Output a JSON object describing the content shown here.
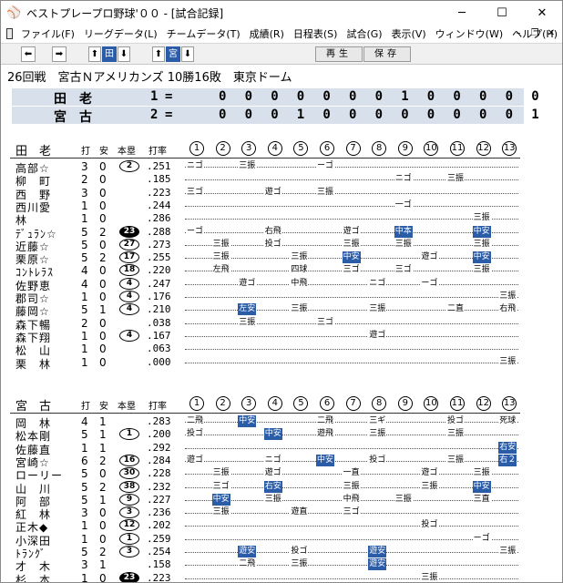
{
  "window": {
    "title": "ベストプレープロ野球'００ - [試合記録]",
    "minimize": "─",
    "maximize": "☐",
    "close": "✕"
  },
  "menu": [
    "ファイル(F)",
    "リーグデータ(L)",
    "チームデータ(T)",
    "成績(R)",
    "日程表(S)",
    "試合(G)",
    "表示(V)",
    "ウィンドウ(W)",
    "ヘルプ(H)"
  ],
  "toolbar": {
    "play": "再生",
    "save": "保存",
    "team1": "田",
    "team2": "宮"
  },
  "game": {
    "info": "26回戦　宮古Ｎアメリカンズ 10勝16敗　東京ドーム"
  },
  "scoreboard": [
    {
      "team": "田　老",
      "order": "1",
      "innings": [
        "0",
        "0",
        "0",
        "0",
        "0",
        "0",
        "0",
        "1",
        "0",
        "0",
        "0",
        "0",
        "0"
      ]
    },
    {
      "team": "宮　古",
      "order": "2",
      "innings": [
        "0",
        "0",
        "0",
        "1",
        "0",
        "0",
        "0",
        "0",
        "0",
        "0",
        "0",
        "0",
        "1"
      ]
    }
  ],
  "headers": {
    "ab": "打",
    "h": "安",
    "hr": "本塁",
    "avg": "打率",
    "innings": [
      "1",
      "2",
      "3",
      "4",
      "5",
      "6",
      "7",
      "8",
      "9",
      "10",
      "11",
      "12",
      "13"
    ]
  },
  "team1": {
    "name": "田　老",
    "players": [
      {
        "name": "高部☆",
        "ab": "3",
        "h": "0",
        "hr": "2",
        "avg": ".251",
        "results": [
          [
            1,
            "ニゴ"
          ],
          [
            3,
            "三振"
          ],
          [
            6,
            "ーゴ"
          ]
        ]
      },
      {
        "name": "柳　町",
        "ab": "2",
        "h": "0",
        "hr": "",
        "avg": ".185",
        "results": [
          [
            9,
            "ニゴ"
          ],
          [
            11,
            "三振"
          ]
        ]
      },
      {
        "name": "西　野",
        "ab": "3",
        "h": "0",
        "hr": "",
        "avg": ".223",
        "results": [
          [
            1,
            "三ゴ"
          ],
          [
            4,
            "遊ゴ"
          ],
          [
            6,
            "三振"
          ]
        ]
      },
      {
        "name": "西川愛",
        "ab": "1",
        "h": "0",
        "hr": "",
        "avg": ".244",
        "results": [
          [
            9,
            "一ゴ"
          ]
        ]
      },
      {
        "name": "林",
        "ab": "1",
        "h": "0",
        "hr": "",
        "avg": ".286",
        "results": [
          [
            12,
            "三振"
          ]
        ]
      },
      {
        "name": "ﾃﾞｭﾗﾝ☆",
        "ab": "5",
        "h": "2",
        "hr": "23",
        "avg": ".288",
        "results": [
          [
            1,
            "ーゴ"
          ],
          [
            4,
            "右飛"
          ],
          [
            7,
            "遊ゴ"
          ],
          [
            9,
            "中本",
            "hl"
          ],
          [
            12,
            "中安",
            "hl"
          ]
        ]
      },
      {
        "name": "近藤☆",
        "ab": "5",
        "h": "0",
        "hr": "27",
        "avg": ".273",
        "results": [
          [
            2,
            "三振"
          ],
          [
            4,
            "投ゴ"
          ],
          [
            7,
            "三振"
          ],
          [
            9,
            "三振"
          ],
          [
            12,
            "三振"
          ]
        ]
      },
      {
        "name": "栗原☆",
        "ab": "5",
        "h": "2",
        "hr": "17",
        "avg": ".255",
        "results": [
          [
            2,
            "三振"
          ],
          [
            5,
            "三振"
          ],
          [
            7,
            "中安",
            "hl"
          ],
          [
            10,
            "遊ゴ"
          ],
          [
            12,
            "中安",
            "hl"
          ]
        ]
      },
      {
        "name": "ｺﾝﾄﾚﾗｽ",
        "ab": "4",
        "h": "0",
        "hr": "18",
        "avg": ".220",
        "results": [
          [
            2,
            "左飛"
          ],
          [
            5,
            "四球"
          ],
          [
            7,
            "三ゴ"
          ],
          [
            9,
            "三ゴ"
          ],
          [
            12,
            "三振"
          ]
        ]
      },
      {
        "name": "佐野恵",
        "ab": "4",
        "h": "0",
        "hr": "4",
        "avg": ".247",
        "results": [
          [
            3,
            "遊ゴ"
          ],
          [
            5,
            "中飛"
          ],
          [
            8,
            "ニゴ"
          ],
          [
            10,
            "ーゴ"
          ]
        ]
      },
      {
        "name": "郡司☆",
        "ab": "1",
        "h": "0",
        "hr": "4",
        "avg": ".176",
        "results": [
          [
            13,
            "三振"
          ]
        ]
      },
      {
        "name": "藤岡☆",
        "ab": "5",
        "h": "1",
        "hr": "4",
        "avg": ".210",
        "results": [
          [
            3,
            "左安",
            "hl"
          ],
          [
            5,
            "三振"
          ],
          [
            8,
            "三振"
          ],
          [
            11,
            "二直"
          ],
          [
            13,
            "右飛"
          ]
        ]
      },
      {
        "name": "森下暢",
        "ab": "2",
        "h": "0",
        "hr": "",
        "avg": ".038",
        "results": [
          [
            3,
            "三振"
          ],
          [
            6,
            "三ゴ"
          ]
        ]
      },
      {
        "name": "森下翔",
        "ab": "1",
        "h": "0",
        "hr": "4",
        "avg": ".167",
        "results": [
          [
            8,
            "遊ゴ"
          ]
        ]
      },
      {
        "name": "松　山",
        "ab": "1",
        "h": "0",
        "hr": "",
        "avg": ".063",
        "results": []
      },
      {
        "name": "栗　林",
        "ab": "1",
        "h": "0",
        "hr": "",
        "avg": ".000",
        "results": [
          [
            13,
            "三振"
          ]
        ]
      }
    ]
  },
  "team2": {
    "name": "宮　古",
    "players": [
      {
        "name": "岡　林",
        "ab": "4",
        "h": "1",
        "hr": "",
        "avg": ".283",
        "results": [
          [
            1,
            "二飛"
          ],
          [
            3,
            "中安",
            "hl"
          ],
          [
            6,
            "二飛"
          ],
          [
            8,
            "三ギ"
          ],
          [
            11,
            "投ゴ"
          ],
          [
            13,
            "死球"
          ]
        ]
      },
      {
        "name": "松本剛",
        "ab": "5",
        "h": "1",
        "hr": "1",
        "avg": ".200",
        "results": [
          [
            1,
            "投ゴ"
          ],
          [
            4,
            "中安",
            "hl"
          ],
          [
            6,
            "遊飛"
          ],
          [
            8,
            "三振"
          ],
          [
            11,
            "三振"
          ]
        ]
      },
      {
        "name": "佐藤直",
        "ab": "1",
        "h": "1",
        "hr": "",
        "avg": ".292",
        "results": [
          [
            13,
            "右安",
            "hl"
          ]
        ]
      },
      {
        "name": "宮崎☆",
        "ab": "6",
        "h": "2",
        "hr": "16",
        "avg": ".284",
        "results": [
          [
            1,
            "遊ゴ"
          ],
          [
            4,
            "ニゴ"
          ],
          [
            6,
            "中安",
            "hl"
          ],
          [
            8,
            "投ゴ"
          ],
          [
            11,
            "三振"
          ],
          [
            13,
            "右２",
            "hl"
          ]
        ]
      },
      {
        "name": "ローリー",
        "ab": "5",
        "h": "0",
        "hr": "30",
        "avg": ".228",
        "results": [
          [
            2,
            "三振"
          ],
          [
            4,
            "遊ゴ"
          ],
          [
            7,
            "一直"
          ],
          [
            10,
            "遊ゴ"
          ],
          [
            12,
            "三振"
          ]
        ]
      },
      {
        "name": "山　川",
        "ab": "5",
        "h": "2",
        "hr": "38",
        "avg": ".232",
        "results": [
          [
            2,
            "三ゴ"
          ],
          [
            4,
            "右安",
            "hl"
          ],
          [
            7,
            "三振"
          ],
          [
            10,
            "三振"
          ],
          [
            12,
            "中安",
            "hl"
          ]
        ]
      },
      {
        "name": "阿　部",
        "ab": "5",
        "h": "1",
        "hr": "9",
        "avg": ".227",
        "results": [
          [
            2,
            "中安",
            "hl"
          ],
          [
            4,
            "三振"
          ],
          [
            7,
            "中飛"
          ],
          [
            9,
            "三振"
          ],
          [
            12,
            "三直"
          ]
        ]
      },
      {
        "name": "紅　林",
        "ab": "3",
        "h": "0",
        "hr": "3",
        "avg": ".236",
        "results": [
          [
            2,
            "三振"
          ],
          [
            5,
            "遊直"
          ],
          [
            7,
            "三ゴ"
          ]
        ]
      },
      {
        "name": "正木◆",
        "ab": "1",
        "h": "0",
        "hr": "12",
        "avg": ".202",
        "results": [
          [
            10,
            "投ゴ"
          ]
        ]
      },
      {
        "name": "小深田",
        "ab": "1",
        "h": "0",
        "hr": "1",
        "avg": ".259",
        "results": [
          [
            12,
            "ーゴ"
          ]
        ]
      },
      {
        "name": "ﾄﾗﾝｸﾞ",
        "ab": "5",
        "h": "2",
        "hr": "3",
        "avg": ".254",
        "results": [
          [
            3,
            "遊安",
            "hl"
          ],
          [
            5,
            "投ゴ"
          ],
          [
            8,
            "遊安",
            "hl"
          ],
          [
            13,
            "三振"
          ]
        ]
      },
      {
        "name": "才　木",
        "ab": "3",
        "h": "1",
        "hr": "",
        "avg": ".158",
        "results": [
          [
            3,
            "二飛"
          ],
          [
            5,
            "三振"
          ],
          [
            8,
            "遊安",
            "hl"
          ]
        ]
      },
      {
        "name": "杉　本",
        "ab": "1",
        "h": "0",
        "hr": "23",
        "avg": ".223",
        "results": [
          [
            10,
            "三振"
          ]
        ]
      },
      {
        "name": "村林◆",
        "ab": "1",
        "h": "0",
        "hr": "",
        "avg": ".179",
        "results": [
          [
            13,
            "ニゴ"
          ]
        ]
      }
    ]
  },
  "colors": {
    "highlight": "#2a5ca8",
    "scoreboard_bg": "#d8e0ec",
    "toolbar_bg": "#f0f0f0"
  }
}
